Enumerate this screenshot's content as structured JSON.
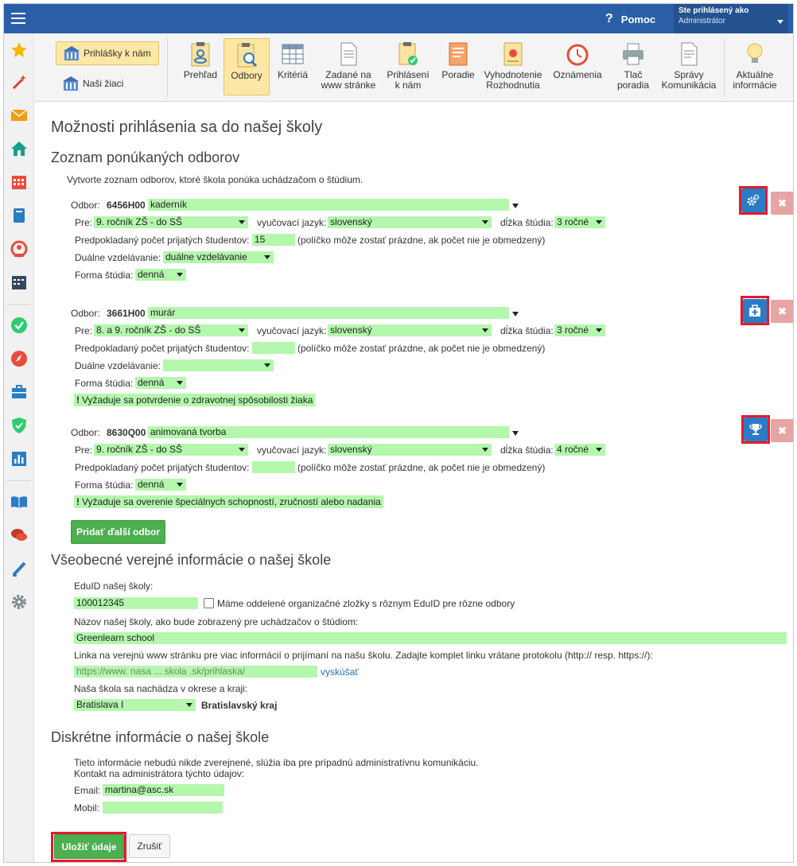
{
  "topbar": {
    "help_label": "Pomoc",
    "user_line1": "Ste prihlásený ako",
    "user_line2": "Administrátor"
  },
  "sidebar": {
    "icons": [
      "star-icon",
      "magic-wand-icon",
      "envelope-icon",
      "home-icon",
      "calendar-grid-icon",
      "book-icon",
      "user-circle-icon",
      "schedule-icon",
      "check-circle-icon",
      "compass-icon",
      "briefcase-icon",
      "shield-check-icon",
      "bar-chart-icon",
      "open-book-icon",
      "chat-icon",
      "pen-icon",
      "gear-icon"
    ]
  },
  "toolbar": {
    "left_buttons": [
      {
        "label": "Prihlášky k nám",
        "active": true
      },
      {
        "label": "Naši žiaci",
        "active": false
      }
    ],
    "items": [
      {
        "label1": "Prehľad",
        "label2": "",
        "icon": "clipboard-eye-icon"
      },
      {
        "label1": "Odbory",
        "label2": "",
        "icon": "clipboard-search-icon",
        "active": true
      },
      {
        "label1": "Kritériá",
        "label2": "",
        "icon": "table-icon"
      },
      {
        "label1": "Zadané na",
        "label2": "www stránke",
        "icon": "document-icon"
      },
      {
        "label1": "Prihlásení",
        "label2": "k nám",
        "icon": "clipboard-check-icon"
      },
      {
        "label1": "Poradie",
        "label2": "",
        "icon": "ranking-document-icon"
      },
      {
        "label1": "Vyhodnotenie",
        "label2": "Rozhodnutia",
        "icon": "certificate-icon"
      },
      {
        "label1": "Oznámenia",
        "label2": "",
        "icon": "clock-alarm-icon"
      },
      {
        "label1": "Tlač",
        "label2": "poradia",
        "icon": "printer-icon"
      },
      {
        "label1": "Správy",
        "label2": "Komunikácia",
        "icon": "message-document-icon"
      },
      {
        "label1": "Aktuálne",
        "label2": "informácie",
        "icon": "lightbulb-icon"
      }
    ]
  },
  "page": {
    "title": "Možnosti prihlásenia sa do našej školy",
    "fields_section_title": "Zoznam ponúkaných odborov",
    "fields_intro": "Vytvorte zoznam odborov, ktoré škola ponúka uchádzačom o štúdium.",
    "labels": {
      "odbor": "Odbor:",
      "pre": "Pre:",
      "language": "vyučovací jazyk:",
      "length": "dĺžka štúdia:",
      "count": "Predpokladaný počet prijatých študentov:",
      "count_note": "(políčko môže zostať prázdne, ak počet nie je obmedzený)",
      "dual": "Duálne vzdelávanie:",
      "form": "Forma štúdia:"
    },
    "fields": [
      {
        "code": "6456H00",
        "name": "kaderník",
        "grade": "9. ročník ZŠ - do SŠ",
        "language": "slovenský",
        "length": "3 ročné",
        "count": "15",
        "dual": "duálne vzdelávanie",
        "form": "denná",
        "notice": "",
        "action_icon": "gears-icon"
      },
      {
        "code": "3661H00",
        "name": "murár",
        "grade": "8. a 9. ročník ZŠ - do SŠ",
        "language": "slovenský",
        "length": "3 ročné",
        "count": "",
        "dual": "",
        "form": "denná",
        "notice": "Vyžaduje sa potvrdenie o zdravotnej spôsobilosti žiaka",
        "action_icon": "medical-kit-icon"
      },
      {
        "code": "8630Q00",
        "name": "animovaná tvorba",
        "grade": "9. ročník ZŠ - do SŠ",
        "language": "slovenský",
        "length": "4 ročné",
        "count": "",
        "dual": null,
        "form": "denná",
        "notice": "Vyžaduje sa overenie špeciálnych schopností, zručností alebo nadania",
        "action_icon": "trophy-icon"
      }
    ],
    "add_field_button": "Pridať ďalší odbor",
    "public_section_title": "Všeobecné verejné informácie o našej škole",
    "eduid_label": "EduID našej školy:",
    "eduid_value": "100012345",
    "eduid_checkbox_label": "Máme oddelené organizačné zložky s rôznym EduID pre rôzne odbory",
    "school_name_label": "Názov našej školy, ako bude zobrazený pre uchádzačov o štúdiom:",
    "school_name_value": "Greenlearn school",
    "web_label": "Linka na verejnú www stránku pre viac informácií o prijímaní na našu školu. Zadajte komplet linku vrátane protokolu (http:// resp. https://):",
    "web_placeholder": "https://www. nasa ... skola .sk/prihlaska/",
    "try_link": "vyskúšať",
    "district_label": "Naša škola sa nachádza v okrese a kraji:",
    "district_value": "Bratislava I",
    "region_value": "Bratislavský kraj",
    "private_section_title": "Diskrétne informácie o našej škole",
    "private_intro1": "Tieto informácie nebudú nikde zverejnené, slúžia iba pre prípadnú administratívnu komunikáciu.",
    "private_intro2": "Kontakt na administrátora týchto údajov:",
    "email_label": "Email:",
    "email_value": "martina@asc.sk",
    "mobile_label": "Mobil:",
    "mobile_value": "",
    "save_button": "Uložiť údaje",
    "cancel_button": "Zrušiť"
  }
}
